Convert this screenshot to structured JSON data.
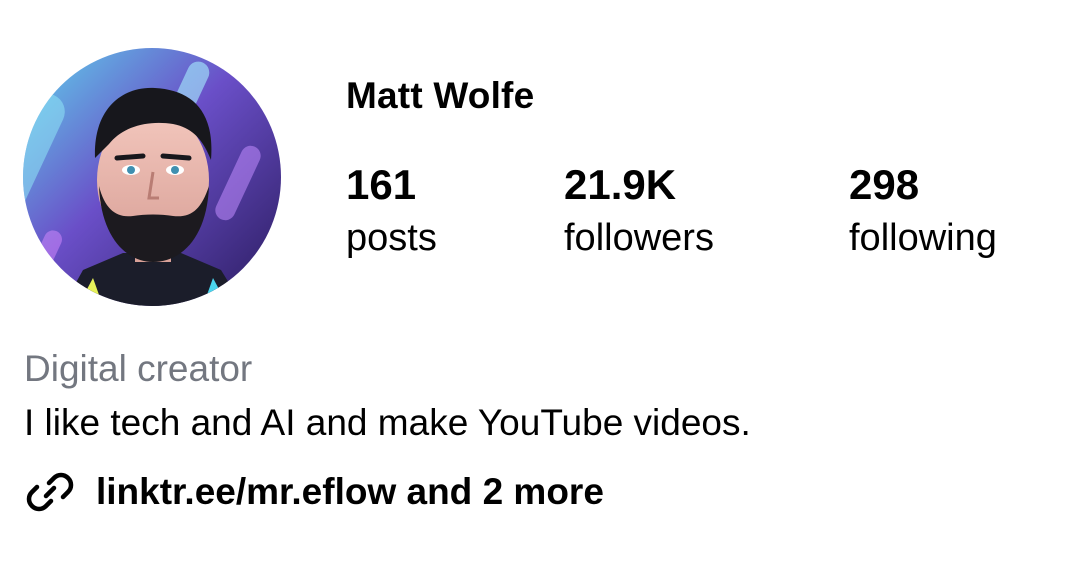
{
  "profile": {
    "username": "Matt Wolfe",
    "avatar_icon": "profile-avatar-illustration"
  },
  "stats": {
    "posts": {
      "value": "161",
      "label": "posts"
    },
    "followers": {
      "value": "21.9K",
      "label": "followers"
    },
    "following": {
      "value": "298",
      "label": "following"
    }
  },
  "bio": {
    "category": "Digital creator",
    "text": "I like tech and AI and make YouTube videos.",
    "link_icon": "link-icon",
    "link_text": "linktr.ee/mr.eflow and 2 more"
  },
  "colors": {
    "text": "#000000",
    "category": "#737780",
    "background": "#ffffff"
  }
}
